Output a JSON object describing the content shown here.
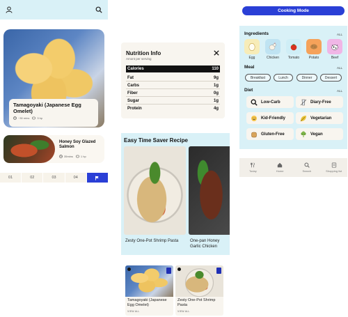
{
  "search": {
    "user_icon": "user-icon",
    "search_icon": "search-icon"
  },
  "hero": {
    "title": "Tamagoyaki (Japanese Egg Omelet)",
    "time": "~30 mins",
    "servings": "3 hp"
  },
  "small_recipe": {
    "title": "Honey Soy Glazed Salmon",
    "time": "35mins",
    "servings": "1 hp"
  },
  "pager": {
    "pages": [
      "01",
      "02",
      "03",
      "04"
    ],
    "flag_icon": "flag-icon"
  },
  "nutrition": {
    "title": "Nutrition Info",
    "subtitle": "Amont per serving",
    "rows": [
      {
        "label": "Calories",
        "value": "110"
      },
      {
        "label": "Fat",
        "value": "9g"
      },
      {
        "label": "Carbs",
        "value": "1g"
      },
      {
        "label": "Fiber",
        "value": "0g"
      },
      {
        "label": "Sugar",
        "value": "1g"
      },
      {
        "label": "Protein",
        "value": "4g"
      }
    ]
  },
  "easy_recipes": {
    "title": "Easy Time Saver Recipe",
    "items": [
      {
        "caption": "Zesty One-Pot Shrimp Pasta"
      },
      {
        "caption": "One-pan Honey Garlic Chicken"
      }
    ]
  },
  "mini_cards": [
    {
      "title": "Tamagoyaki (Japanese Egg Omelet)",
      "view": "VIEW ALL"
    },
    {
      "title": "Zesty One-Pot Shrimp Pasta",
      "view": "VIEW ALL"
    }
  ],
  "cooking_mode": {
    "label": "Cooking Mode"
  },
  "filters": {
    "ingredients_title": "Ingredients",
    "all_label": "ALL",
    "ingredients": [
      {
        "label": "Egg",
        "color": "#f7ecb8",
        "icon": "egg-icon"
      },
      {
        "label": "Chicken",
        "color": "#bfe3f2",
        "icon": "chicken-icon"
      },
      {
        "label": "Tomato",
        "color": "#cfeef6",
        "icon": "tomato-icon"
      },
      {
        "label": "Potato",
        "color": "#f5a25a",
        "icon": "potato-icon"
      },
      {
        "label": "Beef",
        "color": "#f0b6e6",
        "icon": "beef-icon"
      }
    ],
    "meal_title": "Meal",
    "meals": [
      "Breakfast",
      "Lunch",
      "Dinner",
      "Dessert"
    ],
    "diet_title": "Diet",
    "diets": [
      {
        "label": "Low-Carb",
        "icon": "search-icon"
      },
      {
        "label": "Diary-Free",
        "icon": "glass-icon"
      },
      {
        "label": "Kid-Friendly",
        "icon": "kid-icon"
      },
      {
        "label": "Vegetarian",
        "icon": "leaf-icon"
      },
      {
        "label": "Gluten-Free",
        "icon": "bread-icon"
      },
      {
        "label": "Vegan",
        "icon": "broccoli-icon"
      }
    ]
  },
  "tabbar": {
    "tabs": [
      {
        "label": "Today",
        "icon": "utensils-icon"
      },
      {
        "label": "Home",
        "icon": "home-icon"
      },
      {
        "label": "Search",
        "icon": "search-icon"
      },
      {
        "label": "Shopping list",
        "icon": "list-icon"
      }
    ]
  }
}
